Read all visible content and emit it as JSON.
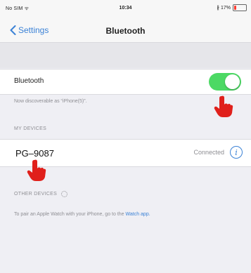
{
  "status_bar": {
    "carrier": "No SIM ᯤ",
    "time": "10:34",
    "battery_text": "∦ 17%",
    "battery_level": 0.17,
    "battery_color": "#ff3b30"
  },
  "nav": {
    "back_label": "Settings",
    "title": "Bluetooth"
  },
  "bluetooth_row": {
    "label": "Bluetooth",
    "toggle_on": true,
    "toggle_color": "#4cd964"
  },
  "discoverable_note": "Now discoverable as “iPhone(5)”.",
  "my_devices": {
    "header": "MY DEVICES",
    "devices": [
      {
        "name": "PG–9087",
        "status": "Connected"
      }
    ]
  },
  "other_devices": {
    "header": "OTHER DEVICES"
  },
  "watch_note": {
    "text": "To pair an Apple Watch with your iPhone, go to the ",
    "link": "Watch app."
  },
  "accent_color": "#3b82d6",
  "pointer_color": "#e0201b"
}
